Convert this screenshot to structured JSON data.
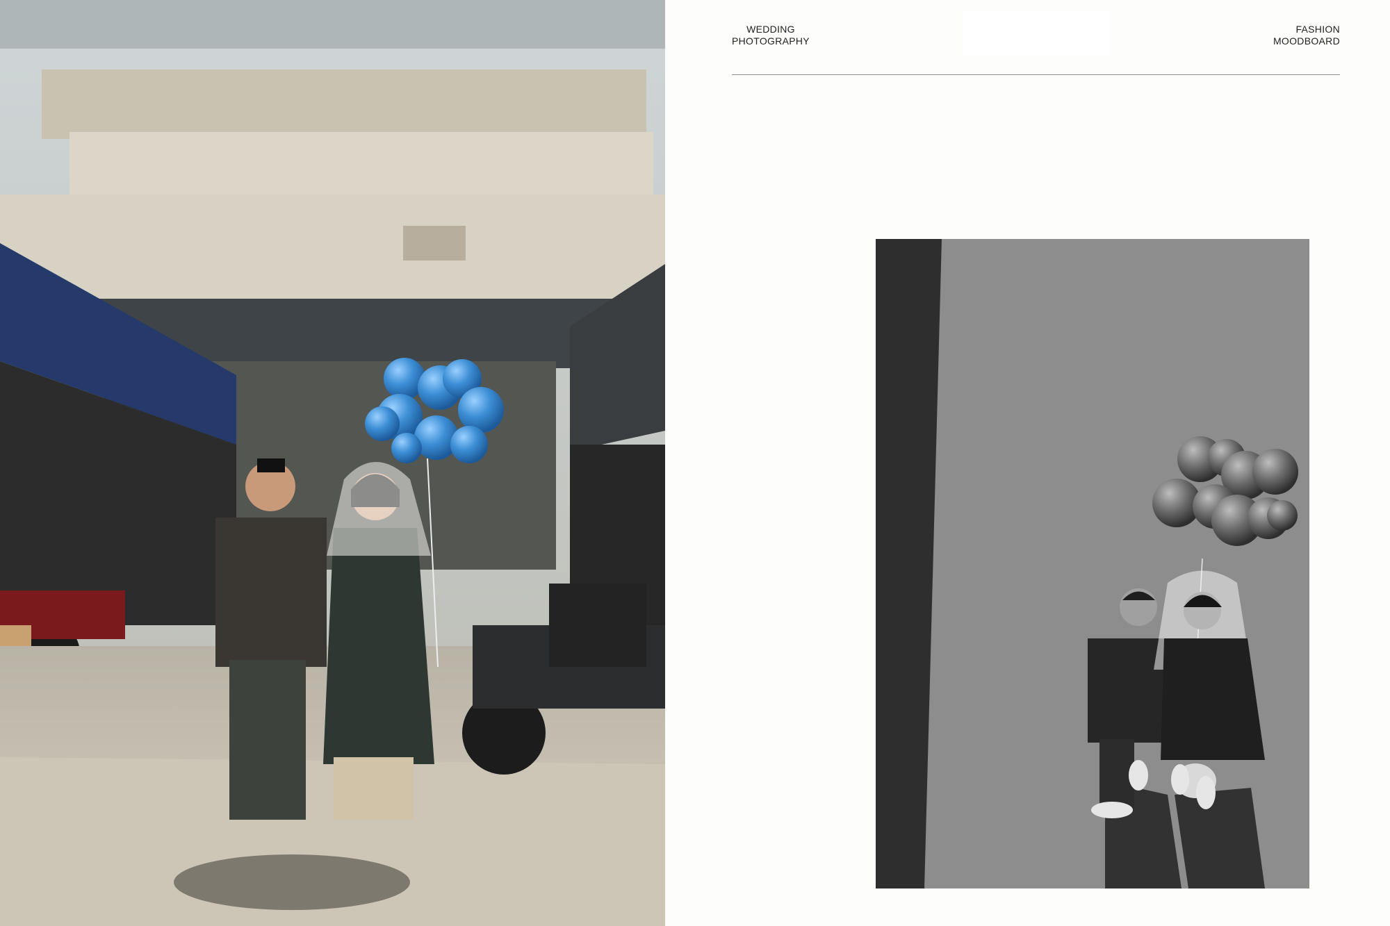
{
  "header": {
    "left_label": [
      "WEDDING",
      "PHOTOGRAPHY"
    ],
    "right_label": [
      "FASHION",
      "MOODBOARD"
    ]
  },
  "photos": {
    "left": {
      "icon": "couple-market-photo",
      "tone": "color",
      "balloon_color": "#3d8fd6"
    },
    "right": {
      "icon": "couple-overhead-photo",
      "tone": "black-and-white"
    }
  },
  "colors": {
    "page_background": "#fdfdfc",
    "rule": "#8a8a8a",
    "text": "#222222"
  }
}
